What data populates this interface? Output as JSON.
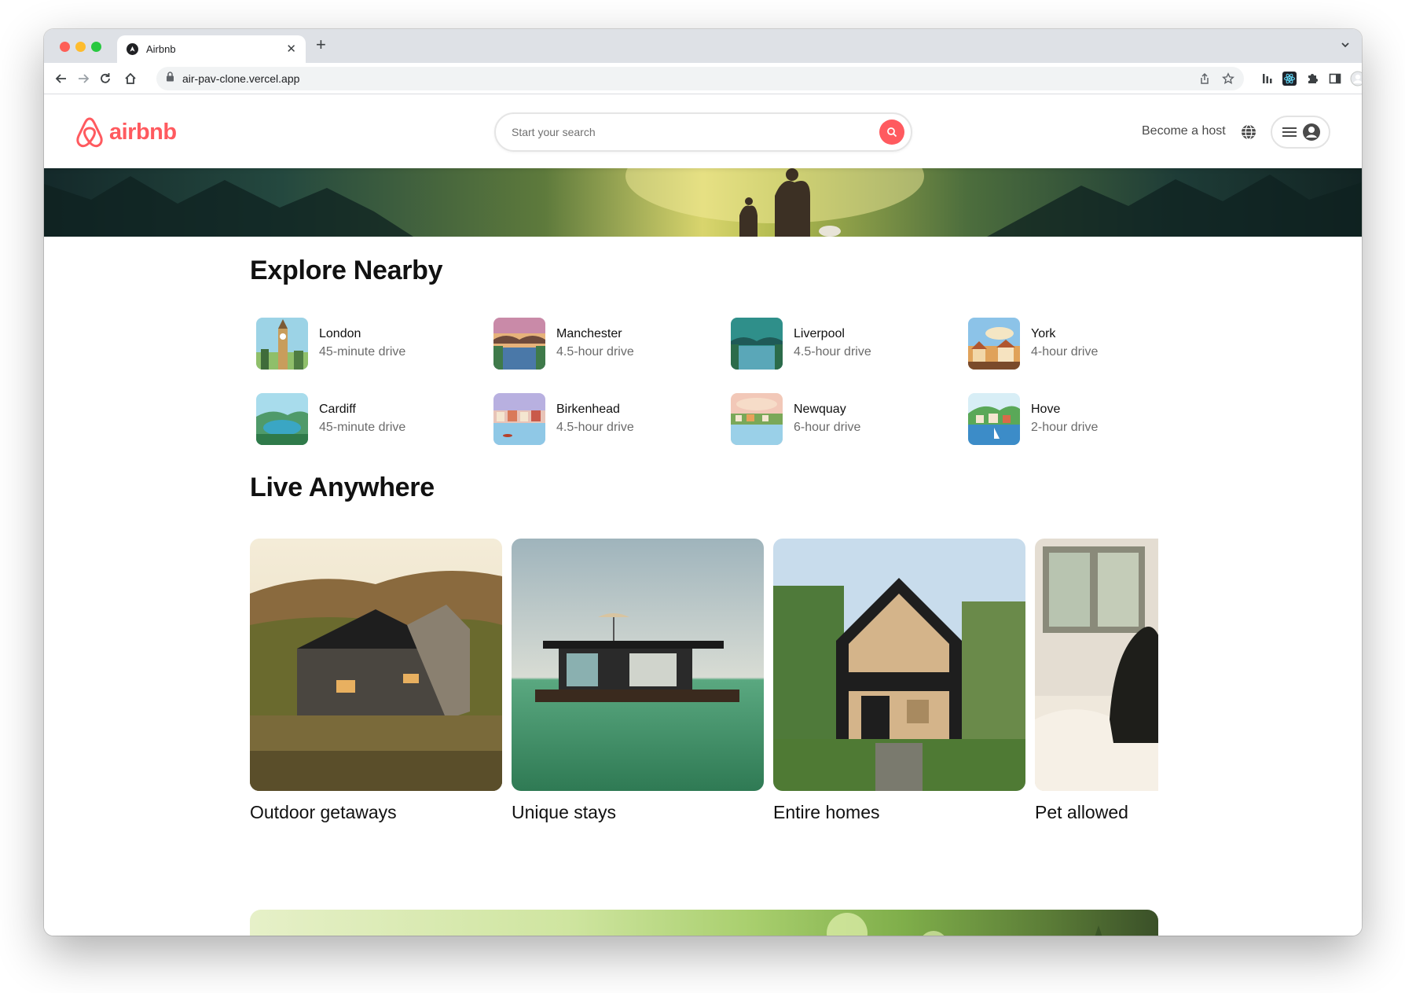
{
  "browser": {
    "tab_title": "Airbnb",
    "url": "air-pav-clone.vercel.app"
  },
  "header": {
    "logo_text": "airbnb",
    "search_placeholder": "Start your search",
    "become_host": "Become a host"
  },
  "explore": {
    "title": "Explore Nearby",
    "items": [
      {
        "city": "London",
        "distance": "45-minute drive"
      },
      {
        "city": "Manchester",
        "distance": "4.5-hour drive"
      },
      {
        "city": "Liverpool",
        "distance": "4.5-hour drive"
      },
      {
        "city": "York",
        "distance": "4-hour drive"
      },
      {
        "city": "Cardiff",
        "distance": "45-minute drive"
      },
      {
        "city": "Birkenhead",
        "distance": "4.5-hour drive"
      },
      {
        "city": "Newquay",
        "distance": "6-hour drive"
      },
      {
        "city": "Hove",
        "distance": "2-hour drive"
      }
    ]
  },
  "live_anywhere": {
    "title": "Live Anywhere",
    "cards": [
      {
        "label": "Outdoor getaways"
      },
      {
        "label": "Unique stays"
      },
      {
        "label": "Entire homes"
      },
      {
        "label": "Pet allowed"
      }
    ]
  },
  "colors": {
    "brand": "#ff5a5f",
    "text": "#111111",
    "muted": "#6b6b6b"
  }
}
